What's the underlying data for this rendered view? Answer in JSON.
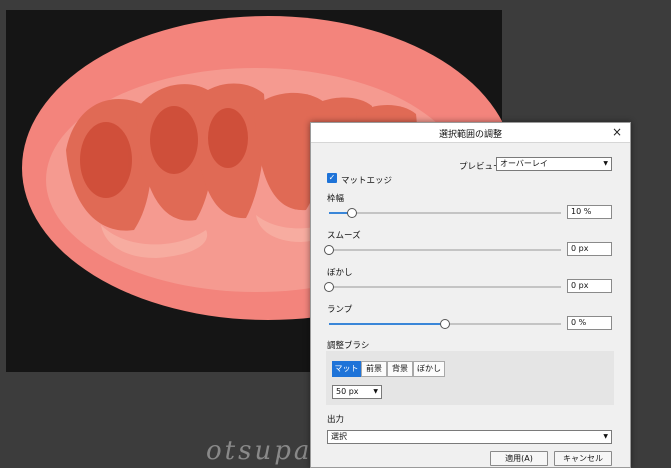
{
  "dialog": {
    "title": "選択範囲の調整",
    "close_icon": "×",
    "preview_label": "プレビュー",
    "preview_value": "オーバーレイ",
    "matte_edge_label": "マットエッジ",
    "matte_edge_checked": true,
    "sliders": [
      {
        "label": "枠幅",
        "value": "10 %",
        "fraction": 0.1
      },
      {
        "label": "スムーズ",
        "value": "0 px",
        "fraction": 0.0
      },
      {
        "label": "ぼかし",
        "value": "0 px",
        "fraction": 0.0
      },
      {
        "label": "ランプ",
        "value": "0 %",
        "fraction": 0.5
      }
    ],
    "brush": {
      "label": "調整ブラシ",
      "modes": [
        "マット",
        "前景",
        "背景",
        "ぼかし"
      ],
      "active_mode": "マット",
      "size_value": "50 px"
    },
    "output": {
      "label": "出力",
      "value": "選択"
    },
    "apply_button": "適用(A)",
    "cancel_button": "キャンセル"
  },
  "watermark": "otsupai.com",
  "colors": {
    "overlay": "#f08a80",
    "accent": "#1e73d8",
    "background": "#3c3c3c"
  }
}
